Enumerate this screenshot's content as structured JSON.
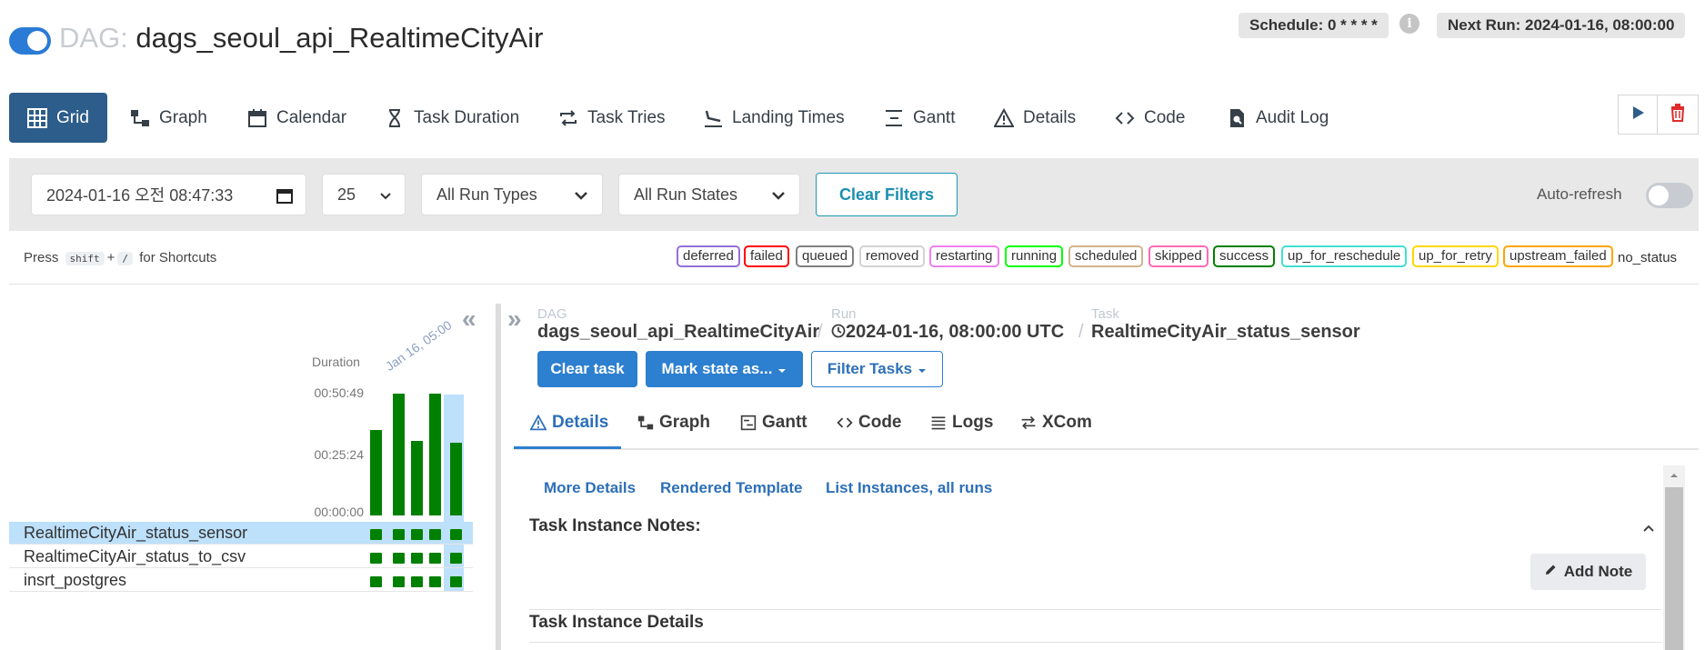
{
  "header": {
    "dag_prefix": "DAG:",
    "dag_id": "dags_seoul_api_RealtimeCityAir",
    "schedule": "Schedule: 0 * * * *",
    "next_run": "Next Run: 2024-01-16, 08:00:00",
    "info_icon": "i"
  },
  "tabs": [
    {
      "label": "Grid",
      "icon": "grid-icon"
    },
    {
      "label": "Graph",
      "icon": "graph-icon"
    },
    {
      "label": "Calendar",
      "icon": "calendar-icon"
    },
    {
      "label": "Task Duration",
      "icon": "hourglass-icon"
    },
    {
      "label": "Task Tries",
      "icon": "repeat-icon"
    },
    {
      "label": "Landing Times",
      "icon": "plane-landing-icon"
    },
    {
      "label": "Gantt",
      "icon": "gantt-icon"
    },
    {
      "label": "Details",
      "icon": "warning-triangle-icon"
    },
    {
      "label": "Code",
      "icon": "code-icon"
    },
    {
      "label": "Audit Log",
      "icon": "audit-log-icon"
    }
  ],
  "filters": {
    "datetime_value": "2024-01-16 오전 08:47:33",
    "num_runs": "25",
    "run_types": "All Run Types",
    "run_states": "All Run States",
    "clear_label": "Clear Filters",
    "autorefresh_label": "Auto-refresh"
  },
  "shortcuts": {
    "press": "Press",
    "key1": "shift",
    "plus": "+",
    "key2": "/",
    "suffix": "for Shortcuts"
  },
  "legend": [
    "deferred",
    "failed",
    "queued",
    "removed",
    "restarting",
    "running",
    "scheduled",
    "skipped",
    "success",
    "up_for_reschedule",
    "up_for_retry",
    "upstream_failed"
  ],
  "legend_colors": {
    "deferred": "#9370db",
    "failed": "#ff0000",
    "queued": "#808080",
    "removed": "#d3d3d3",
    "restarting": "#ee82ee",
    "running": "#00ff00",
    "scheduled": "#d2b48c",
    "skipped": "#ff69b4",
    "success": "#008000",
    "up_for_reschedule": "#40e0d0",
    "up_for_retry": "#ffd700",
    "upstream_failed": "#ffa500"
  },
  "no_status": "no_status",
  "grid": {
    "duration_label": "Duration",
    "ticks": [
      "00:50:49",
      "00:25:24",
      "00:00:00"
    ],
    "date_label": "Jan 16, 05:00",
    "run_durations_fraction": [
      0.7,
      1.0,
      0.61,
      1.0,
      0.6
    ],
    "tasks": [
      "RealtimeCityAir_status_sensor",
      "RealtimeCityAir_status_to_csv",
      "insrt_postgres"
    ],
    "collapse": "«",
    "expand": "»"
  },
  "breadcrumb": {
    "dag_small": "DAG",
    "dag": "dags_seoul_api_RealtimeCityAir",
    "run_small": "Run",
    "run": "2024-01-16, 08:00:00 UTC",
    "task_small": "Task",
    "task": "RealtimeCityAir_status_sensor",
    "sep": "/"
  },
  "actions": {
    "clear": "Clear task",
    "mark": "Mark state as...",
    "filter": "Filter Tasks"
  },
  "subtabs": [
    {
      "label": "Details",
      "icon": "warning-triangle-icon"
    },
    {
      "label": "Graph",
      "icon": "graph-icon"
    },
    {
      "label": "Gantt",
      "icon": "gantt-icon"
    },
    {
      "label": "Code",
      "icon": "code-icon"
    },
    {
      "label": "Logs",
      "icon": "logs-icon"
    },
    {
      "label": "XCom",
      "icon": "xcom-icon"
    }
  ],
  "details": {
    "links": [
      "More Details",
      "Rendered Template",
      "List Instances, all runs"
    ],
    "notes_title": "Task Instance Notes:",
    "add_note": "Add Note",
    "details_title": "Task Instance Details"
  }
}
